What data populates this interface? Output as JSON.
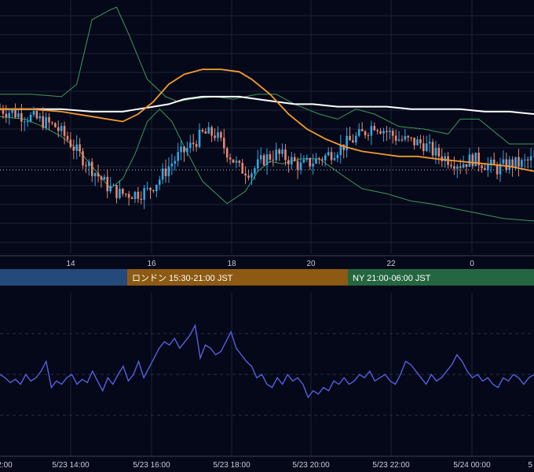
{
  "colors": {
    "background": "#050818",
    "grid": "#1b2238",
    "up_candle": "#2fa7e8",
    "down_candle": "#e9866f",
    "bollinger": "#3c9a5a",
    "ma_short": "#f29a2e",
    "ma_long": "#ffffff",
    "oscillator": "#5560e0",
    "dotted_ref": "#b8bccb",
    "session_tokyo": "#234a7a",
    "session_london": "#8c5a12",
    "session_ny": "#246640"
  },
  "top_axis_ticks": [
    "14",
    "16",
    "18",
    "20",
    "22",
    "0"
  ],
  "bottom_axis_ticks": [
    "2:00",
    "5/23 14:00",
    "5/23 16:00",
    "5/23 18:00",
    "5/23 20:00",
    "5/23 22:00",
    "5/24 00:00",
    "5"
  ],
  "sessions": [
    {
      "name": "tokyo",
      "label": ""
    },
    {
      "name": "london",
      "label": "ロンドン 15:30-21:00 JST"
    },
    {
      "name": "ny",
      "label": "NY 21:00-06:00 JST"
    }
  ],
  "chart_data": {
    "type": "candlestick",
    "x_start_hour": 12.0,
    "x_step_hours": 0.0833,
    "y_range": [
      0,
      100
    ],
    "main": {
      "close_path": [
        [
          0,
          58
        ],
        [
          6,
          56
        ],
        [
          12,
          54
        ],
        [
          18,
          51
        ],
        [
          22,
          46
        ],
        [
          25,
          41
        ],
        [
          30,
          34
        ],
        [
          35,
          27
        ],
        [
          39,
          24
        ],
        [
          44,
          24
        ],
        [
          48,
          25
        ],
        [
          52,
          30
        ],
        [
          55,
          35
        ],
        [
          58,
          39
        ],
        [
          62,
          43
        ],
        [
          66,
          48
        ],
        [
          70,
          48
        ],
        [
          74,
          41
        ],
        [
          78,
          34
        ],
        [
          82,
          33
        ],
        [
          86,
          38
        ],
        [
          90,
          40
        ],
        [
          94,
          38
        ],
        [
          98,
          35
        ],
        [
          102,
          37
        ],
        [
          106,
          39
        ],
        [
          110,
          42
        ],
        [
          114,
          45
        ],
        [
          118,
          48
        ],
        [
          122,
          52
        ],
        [
          126,
          49
        ],
        [
          130,
          46
        ],
        [
          134,
          45
        ],
        [
          138,
          44
        ],
        [
          142,
          40
        ],
        [
          146,
          38
        ],
        [
          150,
          36
        ],
        [
          154,
          38
        ],
        [
          158,
          36
        ],
        [
          162,
          34
        ],
        [
          166,
          36
        ],
        [
          170,
          36
        ],
        [
          174,
          38
        ]
      ],
      "bollinger_upper": [
        [
          0,
          64
        ],
        [
          10,
          64
        ],
        [
          20,
          63
        ],
        [
          25,
          68
        ],
        [
          30,
          94
        ],
        [
          36,
          98
        ],
        [
          38,
          99
        ],
        [
          42,
          88
        ],
        [
          48,
          70
        ],
        [
          54,
          63
        ],
        [
          58,
          61
        ],
        [
          62,
          62
        ],
        [
          70,
          63
        ],
        [
          76,
          62
        ],
        [
          80,
          63
        ],
        [
          84,
          64
        ],
        [
          90,
          64
        ],
        [
          96,
          60
        ],
        [
          104,
          56
        ],
        [
          110,
          54
        ],
        [
          116,
          58
        ],
        [
          122,
          56
        ],
        [
          130,
          51
        ],
        [
          138,
          50
        ],
        [
          146,
          48
        ],
        [
          150,
          54
        ],
        [
          156,
          54
        ],
        [
          160,
          50
        ],
        [
          166,
          44
        ],
        [
          174,
          44
        ]
      ],
      "bollinger_lower": [
        [
          0,
          55
        ],
        [
          8,
          54
        ],
        [
          14,
          51
        ],
        [
          20,
          47
        ],
        [
          26,
          41
        ],
        [
          30,
          35
        ],
        [
          36,
          26
        ],
        [
          40,
          30
        ],
        [
          44,
          40
        ],
        [
          48,
          53
        ],
        [
          52,
          58
        ],
        [
          56,
          53
        ],
        [
          60,
          43
        ],
        [
          66,
          29
        ],
        [
          74,
          20
        ],
        [
          80,
          25
        ],
        [
          84,
          33
        ],
        [
          88,
          37
        ],
        [
          92,
          36
        ],
        [
          98,
          38
        ],
        [
          104,
          38
        ],
        [
          112,
          31
        ],
        [
          118,
          26
        ],
        [
          126,
          24
        ],
        [
          134,
          21
        ],
        [
          140,
          20
        ],
        [
          148,
          18
        ],
        [
          156,
          16
        ],
        [
          164,
          14
        ],
        [
          174,
          13
        ]
      ],
      "ma_short": [
        [
          0,
          58
        ],
        [
          10,
          58
        ],
        [
          20,
          57
        ],
        [
          30,
          55
        ],
        [
          40,
          53
        ],
        [
          45,
          56
        ],
        [
          50,
          61
        ],
        [
          55,
          68
        ],
        [
          60,
          72
        ],
        [
          66,
          74
        ],
        [
          72,
          74
        ],
        [
          78,
          73
        ],
        [
          82,
          70
        ],
        [
          88,
          64
        ],
        [
          94,
          56
        ],
        [
          100,
          50
        ],
        [
          106,
          46
        ],
        [
          112,
          43
        ],
        [
          118,
          41
        ],
        [
          124,
          40
        ],
        [
          130,
          39
        ],
        [
          136,
          39
        ],
        [
          142,
          38
        ],
        [
          150,
          37
        ],
        [
          158,
          36
        ],
        [
          166,
          35
        ],
        [
          174,
          33
        ]
      ],
      "ma_long": [
        [
          0,
          58
        ],
        [
          10,
          58
        ],
        [
          20,
          58
        ],
        [
          30,
          57
        ],
        [
          40,
          57
        ],
        [
          45,
          58
        ],
        [
          50,
          59
        ],
        [
          55,
          60
        ],
        [
          60,
          62
        ],
        [
          66,
          63
        ],
        [
          72,
          63
        ],
        [
          78,
          63
        ],
        [
          84,
          62
        ],
        [
          90,
          61
        ],
        [
          96,
          60
        ],
        [
          102,
          60
        ],
        [
          110,
          59
        ],
        [
          118,
          59
        ],
        [
          126,
          59
        ],
        [
          134,
          58
        ],
        [
          142,
          58
        ],
        [
          150,
          58
        ],
        [
          158,
          57
        ],
        [
          166,
          57
        ],
        [
          174,
          56
        ]
      ]
    },
    "oscillator": {
      "y_range": [
        0,
        100
      ],
      "values": [
        50,
        48,
        45,
        47,
        44,
        50,
        46,
        48,
        52,
        58,
        42,
        46,
        44,
        48,
        50,
        44,
        47,
        45,
        52,
        46,
        40,
        48,
        44,
        50,
        55,
        46,
        50,
        58,
        48,
        54,
        60,
        66,
        70,
        68,
        72,
        66,
        70,
        74,
        80,
        60,
        68,
        66,
        62,
        64,
        70,
        76,
        66,
        62,
        58,
        55,
        48,
        50,
        44,
        42,
        48,
        44,
        50,
        46,
        48,
        44,
        36,
        40,
        38,
        42,
        40,
        46,
        44,
        48,
        44,
        46,
        50,
        48,
        52,
        46,
        48,
        50,
        46,
        44,
        50,
        58,
        56,
        52,
        48,
        44,
        50,
        46,
        48,
        52,
        56,
        62,
        58,
        52,
        48,
        50,
        46,
        48,
        44,
        42,
        48,
        46,
        50,
        48,
        44,
        48,
        50
      ],
      "reference_levels": [
        75,
        50,
        25
      ]
    }
  }
}
